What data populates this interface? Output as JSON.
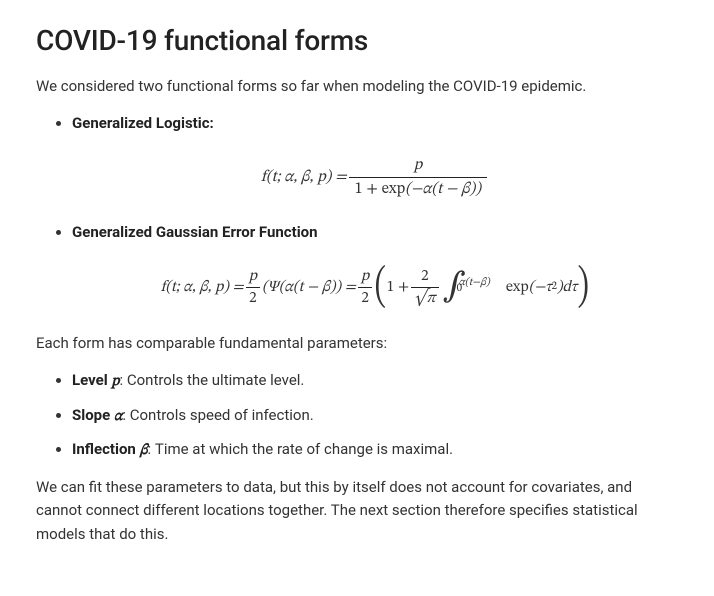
{
  "heading": "COVID-19 functional forms",
  "intro": "We considered two functional forms so far when modeling the COVID-19 epidemic.",
  "forms": [
    {
      "name": "Generalized Logistic:"
    },
    {
      "name": "Generalized Gaussian Error Function"
    }
  ],
  "params_intro": "Each form has comparable fundamental parameters:",
  "params": [
    {
      "name": "Level ",
      "sym": "p",
      "desc": ": Controls the ultimate level."
    },
    {
      "name": "Slope ",
      "sym": "α",
      "desc": ": Controls speed of infection."
    },
    {
      "name": "Inflection ",
      "sym": "β",
      "desc": ": Time at which the rate of change is maximal."
    }
  ],
  "closing": "We can fit these parameters to data, but this by itself does not account for covariates, and cannot connect different locations together. The next section therefore specifies statistical models that do this.",
  "eq1": {
    "lhs": "f(t; α, β, p) = ",
    "num": "p",
    "den_pre": "1 + ",
    "exp": "exp",
    "den_arg": "(−α(t − β))"
  },
  "eq2": {
    "lhs": "f(t; α, β, p) = ",
    "half_num": "p",
    "half_den": "2",
    "psi_part": "(Ψ(α(t − β)) = ",
    "one_plus": "1 + ",
    "two_num": "2",
    "sqrtpi": "√π",
    "int_low": "0",
    "int_up": "α(t−β)",
    "exp": "exp",
    "exp_arg": "(−τ",
    "exp_pow": "2",
    "exp_close": ")",
    "dtau": " dτ"
  }
}
